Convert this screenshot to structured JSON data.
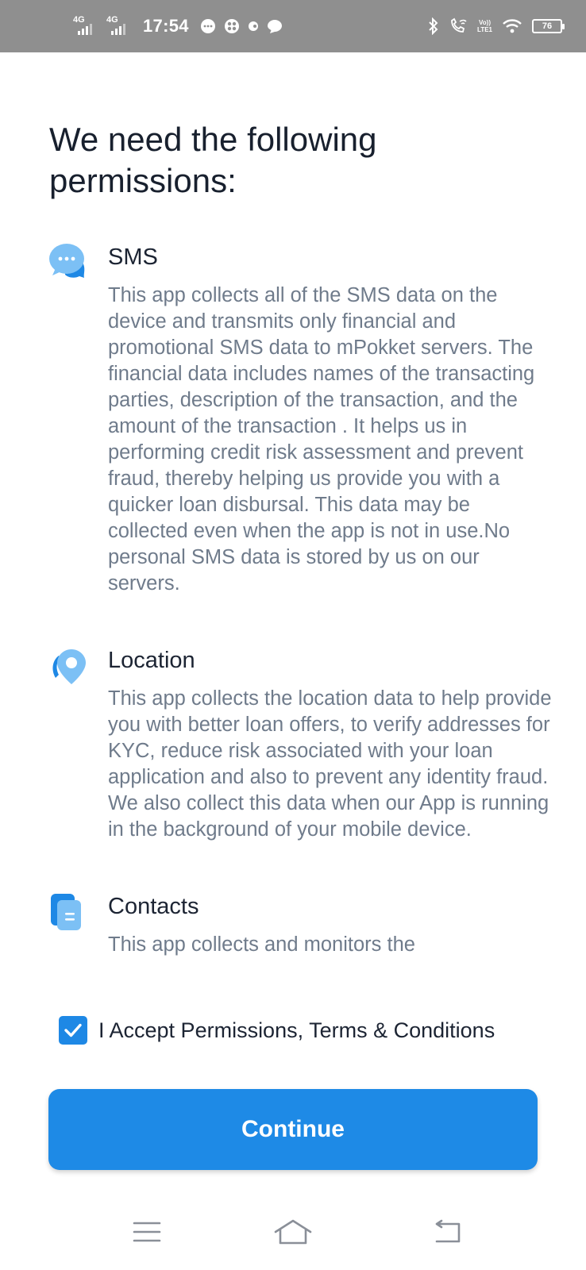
{
  "status_bar": {
    "network1": "4G",
    "network2": "4G",
    "time": "17:54",
    "volte_top": "Vo))",
    "volte_bottom": "LTE1",
    "battery": "76"
  },
  "page": {
    "title": "We need the following permissions:"
  },
  "permissions": [
    {
      "name": "SMS",
      "icon": "chat-bubbles-icon",
      "description": "This app collects all of the SMS data on the device and transmits only financial and promotional SMS data to mPokket servers. The financial data includes names of the transacting parties, description of the transaction, and the amount of the transaction . It helps us in performing credit risk assessment and prevent fraud, thereby helping us provide you with a quicker loan disbursal. This data may be collected even when the app is not in use.No personal SMS data is stored by us on our servers."
    },
    {
      "name": "Location",
      "icon": "location-pin-icon",
      "description": "This app collects the location data to help provide you with better loan offers, to verify addresses for KYC, reduce risk associated with your loan application and also to prevent any identity fraud. We also collect this data when our App is running in the background of your mobile device."
    },
    {
      "name": "Contacts",
      "icon": "contacts-document-icon",
      "description": "This app collects and monitors the"
    }
  ],
  "accept": {
    "checked": true,
    "label": "I Accept Permissions, Terms & Conditions"
  },
  "continue_label": "Continue",
  "colors": {
    "accent": "#1e8ae6",
    "icon_light": "#64b5f6",
    "title": "#18202e",
    "body_text": "#6f7b8b"
  }
}
